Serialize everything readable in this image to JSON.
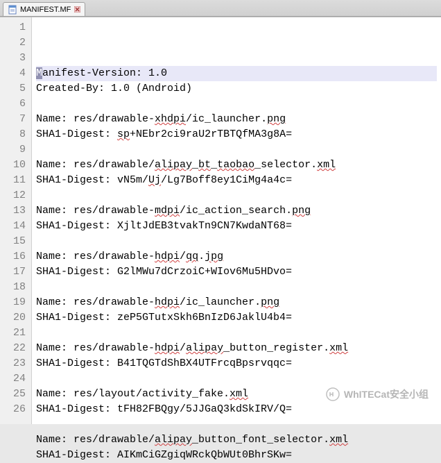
{
  "tab": {
    "filename": "MANIFEST.MF"
  },
  "watermark": {
    "text": "WhITECat安全小组"
  },
  "lines": [
    "Manifest-Version: 1.0",
    "Created-By: 1.0 (Android)",
    "",
    "Name: res/drawable-xhdpi/ic_launcher.png",
    "SHA1-Digest: sp+NEbr2ci9raU2rTBTQfMA3g8A=",
    "",
    "Name: res/drawable/alipay_bt_taobao_selector.xml",
    "SHA1-Digest: vN5m/Uj/Lg7Boff8ey1CiMg4a4c=",
    "",
    "Name: res/drawable-mdpi/ic_action_search.png",
    "SHA1-Digest: XjltJdEB3tvakTn9CN7KwdaNT68=",
    "",
    "Name: res/drawable-hdpi/qq.jpg",
    "SHA1-Digest: G2lMWu7dCrzoiC+WIov6Mu5HDvo=",
    "",
    "Name: res/drawable-hdpi/ic_launcher.png",
    "SHA1-Digest: zeP5GTutxSkh6BnIzD6JaklU4b4=",
    "",
    "Name: res/drawable-hdpi/alipay_button_register.xml",
    "SHA1-Digest: B41TQGTdShBX4UTFrcqBpsrvqqc=",
    "",
    "Name: res/layout/activity_fake.xml",
    "SHA1-Digest: tFH82FBQgy/5JJGaQ3kdSkIRV/Q=",
    "",
    "Name: res/drawable/alipay_button_font_selector.xml",
    "SHA1-Digest: AIKmCiGZgiqWRckQbWUt0BhrSKw="
  ],
  "spell_words": [
    "xhdpi",
    "png",
    "sp",
    "raU",
    "rTBTQfMA",
    "alipay",
    "bt",
    "taobao",
    "xml",
    "vN",
    "Uj",
    "Lg",
    "ey",
    "CiMg",
    "mdpi",
    "XjltJdEB",
    "tvakTn",
    "CN",
    "KwdaNT",
    "hdpi",
    "qq",
    "jpg",
    "lMWu",
    "dCrzoiC",
    "WIov",
    "Mu",
    "HDvo",
    "zeP",
    "GTutxSkh",
    "BnIzD",
    "JaklU",
    "TQGTdShBX",
    "UTFrcqBpsrvqqc",
    "tFH",
    "FBQgy",
    "JJGaQ",
    "kdSkIRV",
    "AIKmCiGZgiqWRckQbWUt",
    "BhrSKw"
  ]
}
